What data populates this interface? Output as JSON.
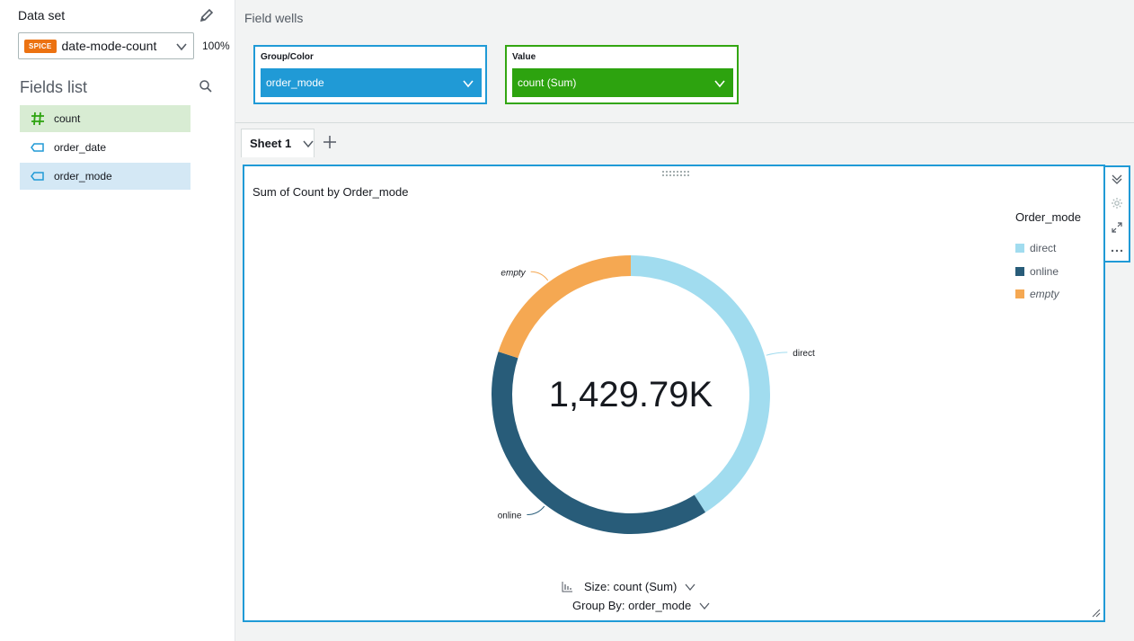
{
  "dataset": {
    "label": "Data set",
    "badge": "SPICE",
    "name": "date-mode-count",
    "percent": "100%"
  },
  "fields_list": {
    "title": "Fields list",
    "items": [
      {
        "label": "count",
        "icon": "hash-icon"
      },
      {
        "label": "order_date",
        "icon": "dimension-tag-icon"
      },
      {
        "label": "order_mode",
        "icon": "dimension-tag-icon"
      }
    ]
  },
  "field_wells": {
    "title": "Field wells",
    "group": {
      "label": "Group/Color",
      "value": "order_mode"
    },
    "value": {
      "label": "Value",
      "value": "count (Sum)"
    }
  },
  "sheets": {
    "tabs": [
      {
        "label": "Sheet 1"
      }
    ]
  },
  "visual": {
    "title": "Sum of Count by Order_mode",
    "center_total": "1,429.79K",
    "size_label": "Size: count (Sum)",
    "group_label": "Group By: order_mode",
    "legend_title": "Order_mode"
  },
  "chart_data": {
    "type": "pie",
    "donut": true,
    "categories": [
      "direct",
      "online",
      "empty"
    ],
    "values": [
      41,
      39,
      20
    ],
    "colors": [
      "#a1dcef",
      "#285c79",
      "#f5a852"
    ],
    "title": "Sum of Count by Order_mode",
    "legend": {
      "title": "Order_mode",
      "position": "top-right"
    },
    "total_label": "1,429.79K"
  }
}
